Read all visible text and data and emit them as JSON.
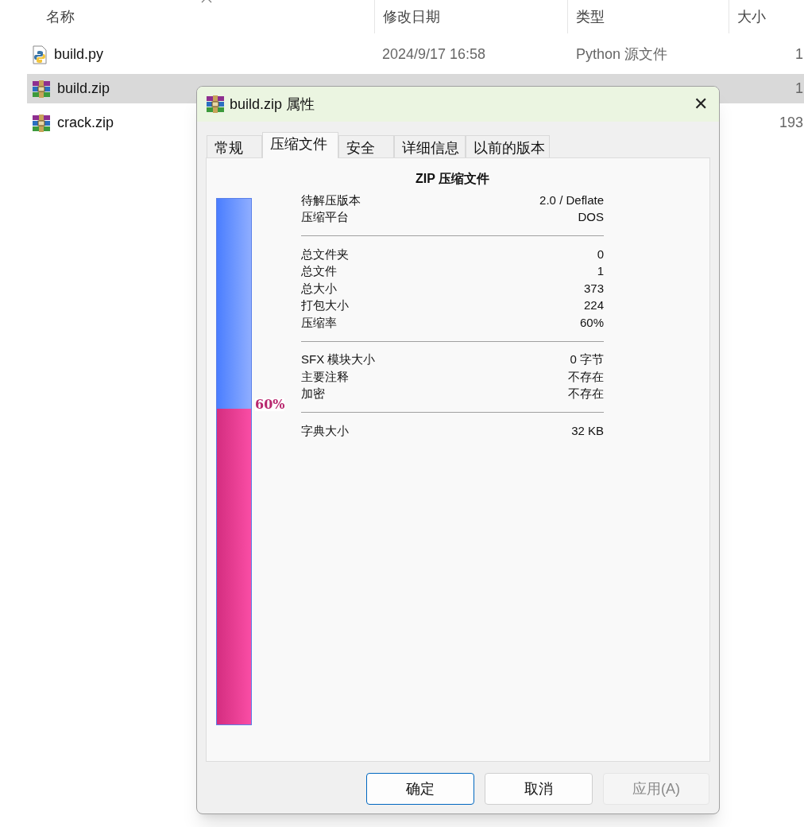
{
  "explorer": {
    "columns": [
      "名称",
      "修改日期",
      "类型",
      "大小"
    ],
    "rows": [
      {
        "name": "build.py",
        "kind": "python",
        "date": "2024/9/17 16:58",
        "type": "Python 源文件",
        "size": "1",
        "selected": false
      },
      {
        "name": "build.zip",
        "kind": "archive",
        "size": "1",
        "selected": true
      },
      {
        "name": "crack.zip",
        "kind": "archive",
        "size": "193",
        "selected": false
      }
    ]
  },
  "dialog": {
    "title": "build.zip 属性",
    "close": "✕",
    "tabs": [
      {
        "label": "常规",
        "selected": false
      },
      {
        "label": "压缩文件",
        "selected": true
      },
      {
        "label": "安全",
        "selected": false
      },
      {
        "label": "详细信息",
        "selected": false
      },
      {
        "label": "以前的版本",
        "selected": false
      }
    ],
    "heading": "ZIP 压缩文件",
    "ratio_bar": {
      "level": 0.6,
      "label": "60%"
    },
    "groups": [
      [
        {
          "label": "待解压版本",
          "value": "2.0 / Deflate"
        },
        {
          "label": "压缩平台",
          "value": "DOS"
        }
      ],
      [
        {
          "label": "总文件夹",
          "value": "0"
        },
        {
          "label": "总文件",
          "value": "1"
        },
        {
          "label": "总大小",
          "value": "373"
        },
        {
          "label": "打包大小",
          "value": "224"
        },
        {
          "label": "压缩率",
          "value": "60%"
        }
      ],
      [
        {
          "label": "SFX 模块大小",
          "value": "0 字节"
        },
        {
          "label": "主要注释",
          "value": "不存在"
        },
        {
          "label": "加密",
          "value": "不存在"
        }
      ],
      [
        {
          "label": "字典大小",
          "value": "32 KB"
        }
      ]
    ],
    "buttons": [
      {
        "label": "确定",
        "kind": "default",
        "disabled": false
      },
      {
        "label": "取消",
        "kind": "normal",
        "disabled": false
      },
      {
        "label": "应用(A)",
        "kind": "normal",
        "disabled": true
      }
    ]
  }
}
